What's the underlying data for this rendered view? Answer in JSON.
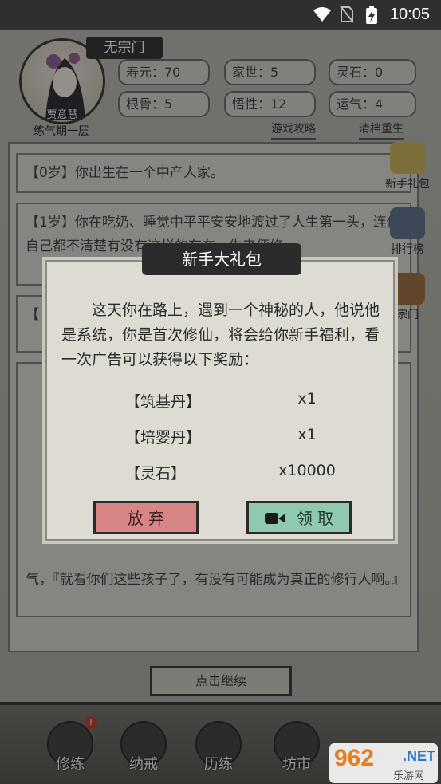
{
  "status_bar": {
    "time": "10:05"
  },
  "header": {
    "character_name": "贾意慧",
    "sect": "无宗门",
    "realm": "练气期一层",
    "stats": [
      {
        "label": "寿元：70"
      },
      {
        "label": "家世：5"
      },
      {
        "label": "灵石：0"
      },
      {
        "label": "根骨：5"
      },
      {
        "label": "悟性：12"
      },
      {
        "label": "运气：4"
      }
    ],
    "guide_link": "游戏攻略",
    "reset_link": "清档重生"
  },
  "side_menu": {
    "gift": "新手礼包",
    "rank": "排行榜",
    "sect": "宗门"
  },
  "log": [
    {
      "text": "【0岁】你出生在一个中产人家。"
    },
    {
      "text": "【1岁】你在吃奶、睡觉中平平安安地渡过了人生第一头，连你自己都不清楚有没有这样的存在，生来便修"
    },
    {
      "text": "【"
    },
    {
      "text": "气，『就看你们这些孩子了，有没有可能成为真正的修行人啊。』"
    }
  ],
  "continue_button": "点击继续",
  "nav": [
    {
      "label": "修练",
      "badge": "!"
    },
    {
      "label": "纳戒"
    },
    {
      "label": "历练"
    },
    {
      "label": "坊市"
    },
    {
      "label": ""
    }
  ],
  "watermark": {
    "number": "962",
    "net": ".NET",
    "sub": "乐游网"
  },
  "modal": {
    "title": "新手大礼包",
    "text": "这天你在路上，遇到一个神秘的人，他说他是系统，你是首次修仙，将会给你新手福利，看一次广告可以获得以下奖励：",
    "rewards": [
      {
        "name": "【筑基丹】",
        "qty": "x1"
      },
      {
        "name": "【培婴丹】",
        "qty": "x1"
      },
      {
        "name": "【灵石】",
        "qty": "x10000"
      }
    ],
    "abandon_label": "放 弃",
    "claim_label": "领 取"
  },
  "colors": {
    "abandon": "#d88685",
    "claim": "#8fc9b2",
    "title_bar": "#2b2b2b"
  }
}
